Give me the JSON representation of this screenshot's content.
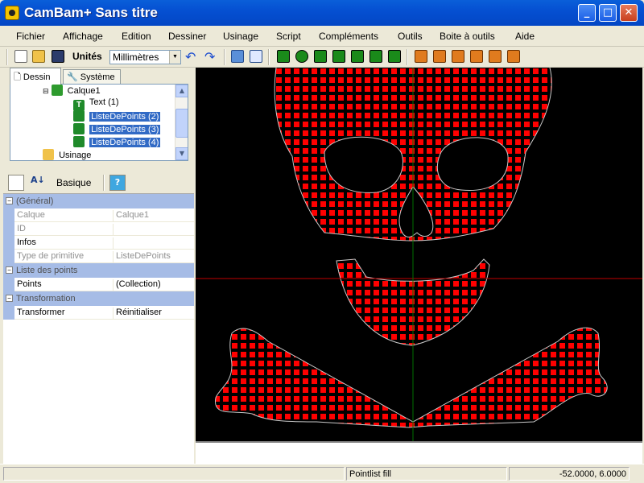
{
  "window": {
    "title": "CamBam+  Sans titre",
    "minimize_glyph": "_",
    "maximize_glyph": "□",
    "close_glyph": "✕"
  },
  "menu": [
    "Fichier",
    "Affichage",
    "Edition",
    "Dessiner",
    "Usinage",
    "Script",
    "Compléments",
    "Outils",
    "Boite à outils",
    "Aide"
  ],
  "toolbar": {
    "units_label": "Unités",
    "units_value": "Millimètres"
  },
  "tabs": {
    "dessin": "Dessin",
    "systeme": "Système"
  },
  "tree": {
    "layer": "Calque1",
    "items": [
      "Text (1)",
      "ListeDePoints (2)",
      "ListeDePoints (3)",
      "ListeDePoints (4)"
    ],
    "usinage": "Usinage"
  },
  "property_toolbar": {
    "mode_label": "Basique"
  },
  "properties": {
    "general": {
      "header": "(Général)",
      "rows": [
        {
          "key": "Calque",
          "value": "Calque1"
        },
        {
          "key": "ID",
          "value": ""
        },
        {
          "key": "Infos",
          "value": ""
        },
        {
          "key": "Type de primitive",
          "value": "ListeDePoints"
        }
      ]
    },
    "points": {
      "header": "Liste des points",
      "rows": [
        {
          "key": "Points",
          "value": "(Collection)"
        }
      ]
    },
    "transform": {
      "header": "Transformation",
      "rows": [
        {
          "key": "Transformer",
          "value": "Réinitialiser"
        }
      ]
    }
  },
  "status": {
    "mode": "Pointlist fill",
    "coords": "-52.0000, 6.0000"
  },
  "colors": {
    "fill": "#ff0000",
    "outline": "#c8c8c8",
    "axis_x": "#c00000",
    "axis_y": "#007000"
  }
}
